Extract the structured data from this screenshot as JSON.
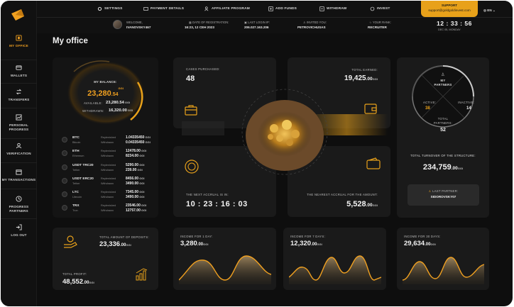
{
  "nav": [
    {
      "label": "MY OFFICE",
      "icon": "office-icon",
      "active": true
    },
    {
      "label": "WALLETS",
      "icon": "wallet-icon"
    },
    {
      "label": "TRANSFERS",
      "icon": "transfer-icon"
    },
    {
      "label": "PERSONAL PROGRESS",
      "icon": "progress-icon"
    },
    {
      "label": "VERIFICATION",
      "icon": "user-icon"
    },
    {
      "label": "MY TRANSACTIONS",
      "icon": "calendar-icon"
    },
    {
      "label": "PROGRESS PARTNERS",
      "icon": "clock-icon"
    },
    {
      "label": "LOG OUT",
      "icon": "logout-icon"
    }
  ],
  "topnav": {
    "settings": "SETTINGS",
    "payment": "PAYMENT DETAILS",
    "affiliate": "AFFILIATE PROGRAM",
    "add_funds": "ADD FUNDS",
    "withdraw": "WITHDRAW",
    "invest": "INVEST"
  },
  "support": {
    "label": "SUPPORT",
    "email": "support@goldgoldinvest.com"
  },
  "lang": "EN",
  "user": {
    "welcome_label": "WELCOME,",
    "welcome_value": "IVANOVSKY467",
    "reg_label": "DATE OF REGISTRATION:",
    "reg_value": "16:23, 12 CEH 2023",
    "login_label": "LAST LOGIN IP:",
    "login_value": "206.027.163.206",
    "invited_label": "INVITED YOU:",
    "invited_value": "PETROVICHUSAS",
    "rank_label": "YOUR RANK:",
    "rank_value": "RECRUITER"
  },
  "clock": {
    "time": "12 : 33 : 56",
    "date": "DEC 05, MONDAY"
  },
  "page_title": "My office",
  "balance": {
    "label": "MY BALANCE:",
    "value_main": "23,280",
    "value_dec": ".54",
    "currency": "GGI",
    "available_label": "AVAILABLE:",
    "available_value": "23,280.54",
    "withdrawn_label": "WITHDRAWN:",
    "withdrawn_value": "16,320.00"
  },
  "coins": [
    {
      "sym": "BTC",
      "name": "Bitcoin",
      "replenished": "1.04335450",
      "withdrawn": "0.04335450",
      "l1": "Replenished",
      "l2": "Withdrawn"
    },
    {
      "sym": "ETH",
      "name": "Ethereum",
      "replenished": "12478.00",
      "withdrawn": "8234.00",
      "l1": "Replenished",
      "l2": "Withdrawn"
    },
    {
      "sym": "USDT TRC20",
      "name": "Tether",
      "replenished": "5290.00",
      "withdrawn": "239.00",
      "l1": "Replenished",
      "l2": "Withdrawn"
    },
    {
      "sym": "USDT ERC20",
      "name": "Tether",
      "replenished": "8456.00",
      "withdrawn": "3490.00",
      "l1": "Replenished",
      "l2": "Withdrawn"
    },
    {
      "sym": "LTC",
      "name": "Litecoin",
      "replenished": "7345.00",
      "withdrawn": "3490.00",
      "l1": "Replenished",
      "l2": "Withdrawn"
    },
    {
      "sym": "TRX",
      "name": "Tron",
      "replenished": "23546.00",
      "withdrawn": "12757.00",
      "l1": "Replenished",
      "l2": "Withdrawn"
    }
  ],
  "cases": {
    "label": "CASES PURCHASED:",
    "value": "48"
  },
  "earned": {
    "label": "TOTAL EARNED:",
    "value": "19,425",
    "dec": ".00",
    "currency": "GGI"
  },
  "next_accrual": {
    "label": "THE NEXT ACCRUAL IS IN:",
    "value": "10 : 23 : 16 : 03"
  },
  "nearest": {
    "label": "THE NEAREST ACCRUAL FOR THE AMOUNT:",
    "value": "5,528",
    "dec": ".00",
    "currency": "GGI"
  },
  "partners": {
    "title1": "MY",
    "title2": "PARTNERS",
    "active_label": "ACTIVE:",
    "active_value": "38",
    "inactive_label": "INACTIVE:",
    "inactive_value": "14",
    "total_label": "TOTAL",
    "total_label2": "PARTNERS:",
    "total_value": "52",
    "turnover_label": "TOTAL TURNOVER OF THE STRUCTURE:",
    "turnover_value": "234,759",
    "turnover_dec": ".00",
    "currency": "GGI",
    "last_label": "LAST PARTNER:",
    "last_value": "SIDOROVSKY07"
  },
  "deposits": {
    "label": "TOTAL AMOUNT OF DEPOSITS:",
    "value": "23,336",
    "dec": ".00",
    "currency": "GGI",
    "profit_label": "TOTAL PROFIT:",
    "profit_value": "48,552",
    "profit_dec": ".00"
  },
  "income": [
    {
      "label": "INCOME FOR 1 DAY:",
      "value": "3,280",
      "dec": ".00",
      "currency": "GGI"
    },
    {
      "label": "INCOME FOR 7 DAYS:",
      "value": "12,320",
      "dec": ".00",
      "currency": "GGI"
    },
    {
      "label": "INCOME FOR 30 DAYS:",
      "value": "29,634",
      "dec": ".00",
      "currency": "GGI"
    }
  ],
  "colors": {
    "accent": "#e8a11a",
    "bg": "#0e0e0e",
    "card": "#1a1a1a"
  }
}
